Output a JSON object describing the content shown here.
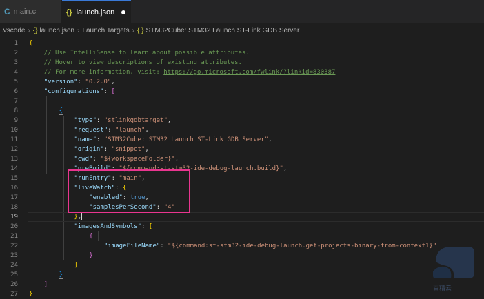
{
  "tabs": [
    {
      "label": "main.c",
      "icon": "c-file-icon",
      "active": false
    },
    {
      "label": "launch.json",
      "icon": "json-braces-icon",
      "active": true,
      "modified": true
    }
  ],
  "breadcrumb": [
    ".vscode",
    "launch.json",
    "Launch Targets",
    "STM32Cube: STM32 Launch ST-Link GDB Server"
  ],
  "editor": {
    "current_line": 19,
    "lines": [
      {
        "n": 1,
        "indent": 0,
        "t": [
          [
            "b1",
            "{"
          ]
        ]
      },
      {
        "n": 2,
        "indent": 4,
        "t": [
          [
            "cm",
            "// Use IntelliSense to learn about possible attributes."
          ]
        ]
      },
      {
        "n": 3,
        "indent": 4,
        "t": [
          [
            "cm",
            "// Hover to view descriptions of existing attributes."
          ]
        ]
      },
      {
        "n": 4,
        "indent": 4,
        "t": [
          [
            "cm",
            "// For more information, visit: "
          ],
          [
            "link",
            "https://go.microsoft.com/fwlink/?linkid=830387"
          ]
        ]
      },
      {
        "n": 5,
        "indent": 4,
        "t": [
          [
            "k",
            "\"version\""
          ],
          [
            "p",
            ": "
          ],
          [
            "s",
            "\"0.2.0\""
          ],
          [
            "p",
            ","
          ]
        ]
      },
      {
        "n": 6,
        "indent": 4,
        "t": [
          [
            "k",
            "\"configurations\""
          ],
          [
            "p",
            ": "
          ],
          [
            "b2",
            "["
          ]
        ]
      },
      {
        "n": 7,
        "indent": 0,
        "t": []
      },
      {
        "n": 8,
        "indent": 8,
        "t": [
          [
            "b3 bracket-box",
            "{"
          ]
        ]
      },
      {
        "n": 9,
        "indent": 12,
        "t": [
          [
            "k",
            "\"type\""
          ],
          [
            "p",
            ": "
          ],
          [
            "s",
            "\"stlinkgdbtarget\""
          ],
          [
            "p",
            ","
          ]
        ]
      },
      {
        "n": 10,
        "indent": 12,
        "t": [
          [
            "k",
            "\"request\""
          ],
          [
            "p",
            ": "
          ],
          [
            "s",
            "\"launch\""
          ],
          [
            "p",
            ","
          ]
        ]
      },
      {
        "n": 11,
        "indent": 12,
        "t": [
          [
            "k",
            "\"name\""
          ],
          [
            "p",
            ": "
          ],
          [
            "s",
            "\"STM32Cube: STM32 Launch ST-Link GDB Server\""
          ],
          [
            "p",
            ","
          ]
        ]
      },
      {
        "n": 12,
        "indent": 12,
        "t": [
          [
            "k",
            "\"origin\""
          ],
          [
            "p",
            ": "
          ],
          [
            "s",
            "\"snippet\""
          ],
          [
            "p",
            ","
          ]
        ]
      },
      {
        "n": 13,
        "indent": 12,
        "t": [
          [
            "k",
            "\"cwd\""
          ],
          [
            "p",
            ": "
          ],
          [
            "s",
            "\"${workspaceFolder}\""
          ],
          [
            "p",
            ","
          ]
        ]
      },
      {
        "n": 14,
        "indent": 12,
        "t": [
          [
            "k",
            "\"preBuild\""
          ],
          [
            "p",
            ": "
          ],
          [
            "s",
            "\"${command:st-stm32-ide-debug-launch.build}\""
          ],
          [
            "p",
            ","
          ]
        ]
      },
      {
        "n": 15,
        "indent": 12,
        "t": [
          [
            "k",
            "\"runEntry\""
          ],
          [
            "p",
            ": "
          ],
          [
            "s",
            "\"main\""
          ],
          [
            "p",
            ","
          ]
        ]
      },
      {
        "n": 16,
        "indent": 12,
        "t": [
          [
            "k",
            "\"liveWatch\""
          ],
          [
            "p",
            ": "
          ],
          [
            "b1",
            "{"
          ]
        ]
      },
      {
        "n": 17,
        "indent": 16,
        "t": [
          [
            "k",
            "\"enabled\""
          ],
          [
            "p",
            ": "
          ],
          [
            "bool",
            "true"
          ],
          [
            "p",
            ","
          ]
        ]
      },
      {
        "n": 18,
        "indent": 16,
        "t": [
          [
            "k",
            "\"samplesPerSecond\""
          ],
          [
            "p",
            ": "
          ],
          [
            "s",
            "\"4\""
          ]
        ]
      },
      {
        "n": 19,
        "indent": 12,
        "t": [
          [
            "b1",
            "}"
          ],
          [
            "p",
            ","
          ]
        ],
        "caret": true
      },
      {
        "n": 20,
        "indent": 12,
        "t": [
          [
            "k",
            "\"imagesAndSymbols\""
          ],
          [
            "p",
            ": "
          ],
          [
            "b1",
            "["
          ]
        ]
      },
      {
        "n": 21,
        "indent": 16,
        "t": [
          [
            "b2",
            "{"
          ]
        ]
      },
      {
        "n": 22,
        "indent": 20,
        "t": [
          [
            "k",
            "\"imageFileName\""
          ],
          [
            "p",
            ": "
          ],
          [
            "s",
            "\"${command:st-stm32-ide-debug-launch.get-projects-binary-from-context1}\""
          ]
        ]
      },
      {
        "n": 23,
        "indent": 16,
        "t": [
          [
            "b2",
            "}"
          ]
        ]
      },
      {
        "n": 24,
        "indent": 12,
        "t": [
          [
            "b1",
            "]"
          ]
        ]
      },
      {
        "n": 25,
        "indent": 8,
        "t": [
          [
            "b3 bracket-box",
            "}"
          ]
        ]
      },
      {
        "n": 26,
        "indent": 4,
        "t": [
          [
            "b2",
            "]"
          ]
        ]
      },
      {
        "n": 27,
        "indent": 0,
        "t": [
          [
            "b1",
            "}"
          ]
        ]
      }
    ]
  },
  "watermark": {
    "text": "百精云",
    "icon": "cloud-logo-icon"
  }
}
